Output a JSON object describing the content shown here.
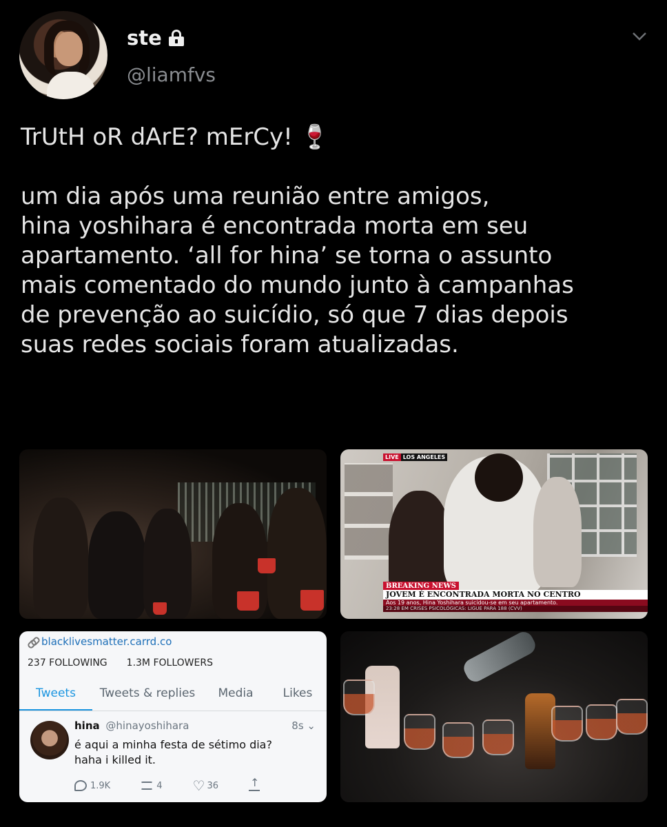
{
  "header": {
    "display_name": "ste",
    "handle": "@liamfvs",
    "avatar_icon": "user-avatar",
    "lock_icon": "lock-icon",
    "menu_icon": "chevron-down-icon"
  },
  "tweet": {
    "text": "TrUtH oR dArE? mErCy! 🍷\n\num dia após uma reunião entre amigos,\nhina yoshihara é encontrada morta em seu\napartamento. ‘all for hina’ se torna o assunto\nmais comentado do mundo junto à campanhas\nde prevenção ao suicídio, só que 7 dias depois\nsuas redes sociais foram atualizadas."
  },
  "media": {
    "news": {
      "live": "LIVE",
      "location": "LOS ANGELES",
      "tag": "BREAKING NEWS",
      "headline": "JOVEM É ENCONTRADA MORTA NO CENTRO",
      "sub1": "Aos 19 anos, Hina Yoshihara suicidou-se em seu apartamento.",
      "sub2": "23:28    EM CRISES PSICOLÓGICAS: LIGUE PARA 188 (CVV)"
    },
    "profile": {
      "link": "blacklivesmatter.carrd.co",
      "following": "237 FOLLOWING",
      "followers": "1.3M FOLLOWERS",
      "tabs": [
        "Tweets",
        "Tweets & replies",
        "Media",
        "Likes"
      ],
      "tweet_name": "hina",
      "tweet_handle": "@hinayoshihara",
      "tweet_time": "8s",
      "tweet_text": "é aqui a minha festa de sétimo dia?\nhaha i killed it.",
      "replies": "1.9K",
      "retweets": "4",
      "likes": "36"
    }
  },
  "colors": {
    "background": "#000000",
    "text": "#e6e6e6",
    "muted": "#8a8d91",
    "twitter_blue": "#1b95e0",
    "news_red": "#c8102e"
  }
}
